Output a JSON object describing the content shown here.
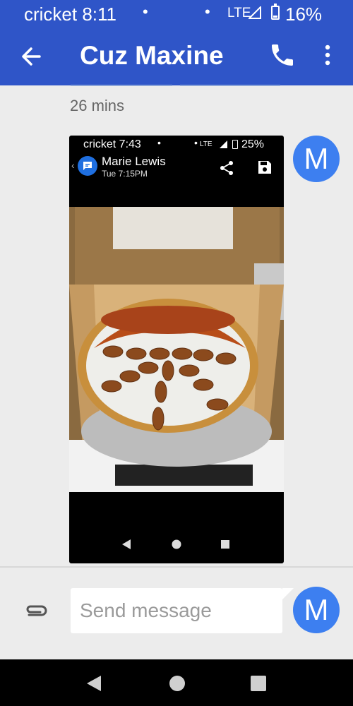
{
  "status_bar": {
    "carrier_time": "cricket 8:11",
    "network": "LTE",
    "battery": "16%"
  },
  "app_bar": {
    "title": "Cuz Maxine",
    "back_icon": "arrow-back-icon",
    "call_icon": "phone-icon",
    "menu_icon": "more-vert-icon"
  },
  "conversation": {
    "timestamp": "26 mins",
    "sender_initial": "M",
    "attachment": {
      "status": {
        "carrier_time": "cricket 7:43",
        "network": "LTE",
        "battery": "25%"
      },
      "contact_name": "Marie Lewis",
      "contact_time": "Tue 7:15PM",
      "share_icon": "share-icon",
      "save_icon": "save-icon",
      "photo_description_icon": "pecan-pie-photo"
    }
  },
  "composer": {
    "placeholder": "Send message",
    "attach_icon": "paperclip-icon",
    "avatar_initial": "M"
  },
  "colors": {
    "brand": "#2f55c8",
    "avatar": "#3d7ff0",
    "background": "#ececec"
  }
}
